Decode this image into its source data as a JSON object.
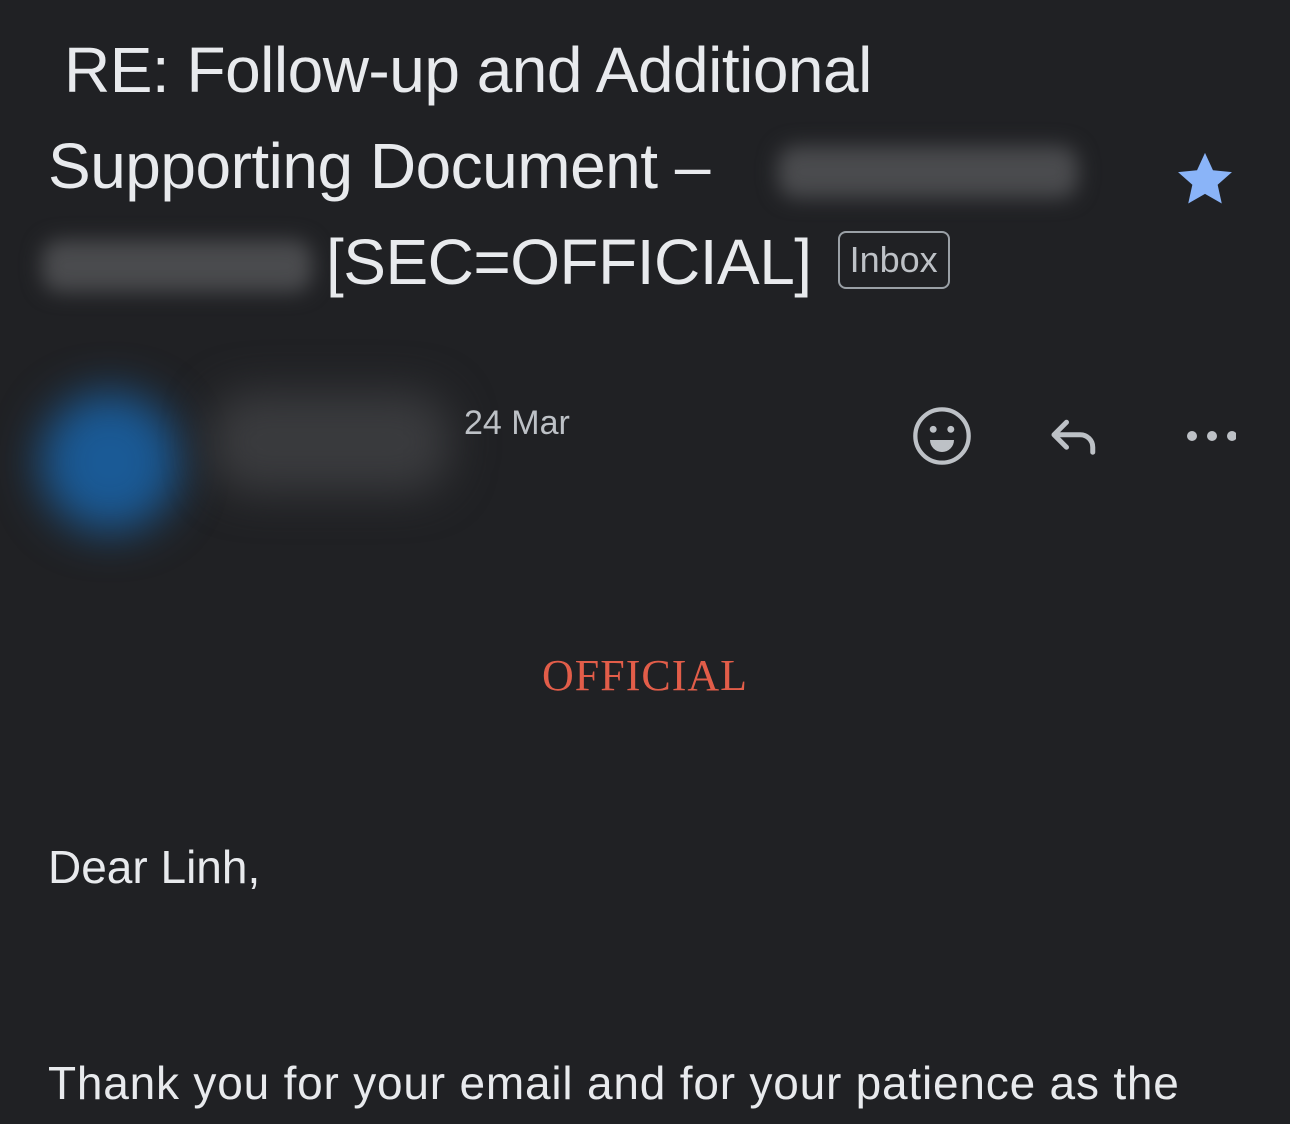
{
  "email": {
    "subject_lines": [
      "RE: Follow-up and Additional",
      "Supporting Document –",
      "[SEC=OFFICIAL]"
    ],
    "label_badge": "Inbox",
    "starred": true,
    "date": "24 Mar",
    "classification_banner": "OFFICIAL",
    "greeting": "Dear Linh,",
    "body_first_line": "Thank you for your email and for your patience as the"
  },
  "actions": {
    "emoji_icon": "emoji-reaction-icon",
    "reply_icon": "reply-icon",
    "more_icon": "more-options-icon"
  },
  "colors": {
    "background": "#202124",
    "star": "#8ab4f8",
    "classification": "#e25d49",
    "avatar": "#1a5a96"
  }
}
